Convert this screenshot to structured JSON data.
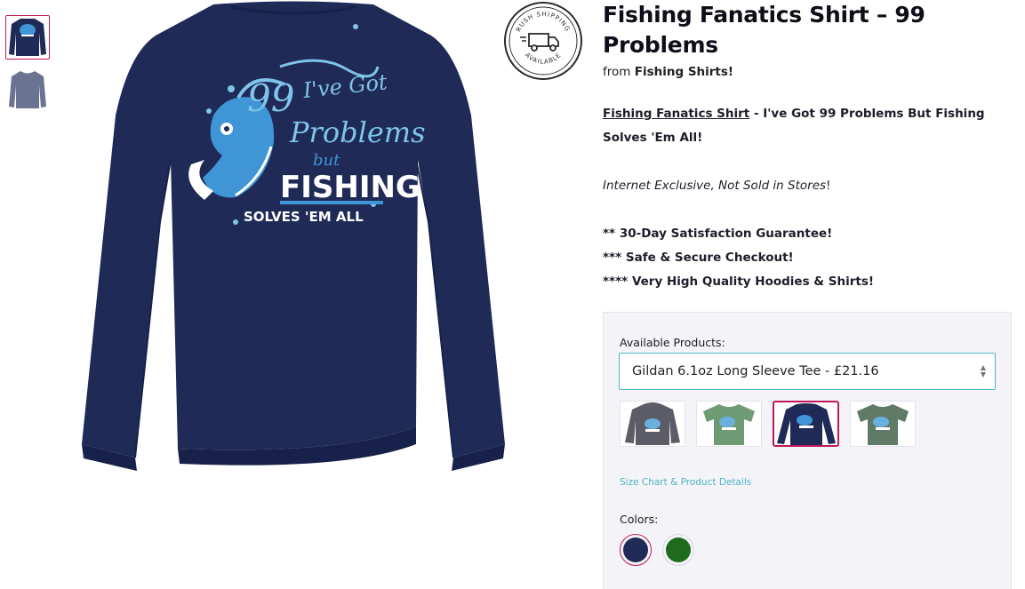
{
  "product": {
    "title": "Fishing Fanatics Shirt – 99 Problems",
    "from_prefix": "from",
    "store_name": "Fishing Shirts!",
    "link_text": "Fishing Fanatics Shirt",
    "tagline": " - I've Got 99 Problems But Fishing Solves 'Em All!",
    "exclusive_text": "Internet Exclusive, Not Sold in Stores",
    "exclusive_suffix": "!",
    "bullets": [
      "** 30-Day Satisfaction Guarantee!",
      "*** Safe & Secure Checkout!",
      "**** Very High Quality Hoodies & Shirts!"
    ]
  },
  "badge": {
    "top_text": "RUSH SHIPPING",
    "bottom_text": "AVAILABLE",
    "icon": "truck-icon"
  },
  "design": {
    "line1": "I've Got",
    "line2": "99",
    "line3": "Problems",
    "line4": "but",
    "line5": "FISHING",
    "line6": "SOLVES 'EM ALL"
  },
  "selector": {
    "label": "Available Products:",
    "selected": "Gildan 6.1oz Long Sleeve Tee - £21.16",
    "size_chart_link": "Size Chart & Product Details",
    "colors_label": "Colors:"
  },
  "colors": {
    "navy": "#1f2a57",
    "green": "#1e6b1e",
    "accent": "#c2185b",
    "link": "#4fb3c4",
    "shirt": "#1f2a57",
    "print_light": "#7fc4ea",
    "print_mid": "#3f95d6"
  }
}
